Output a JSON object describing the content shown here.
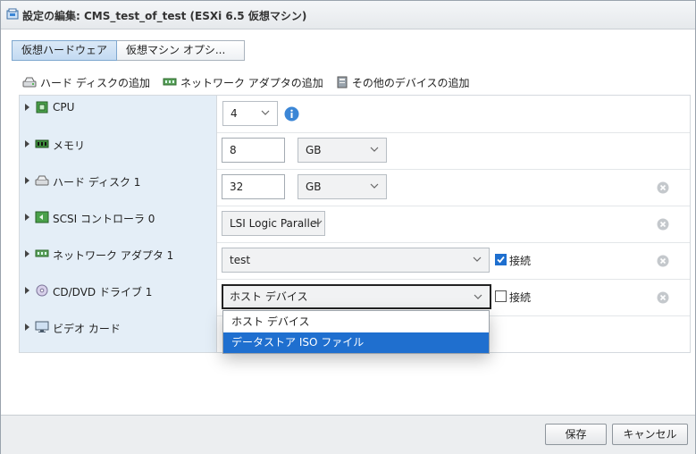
{
  "window": {
    "title": "設定の編集: CMS_test_of_test (ESXi 6.5 仮想マシン)",
    "icon": "vm-settings-icon"
  },
  "tabs": [
    {
      "label": "仮想ハードウェア",
      "active": true
    },
    {
      "label": "仮想マシン オプシ...",
      "active": false
    }
  ],
  "actions": [
    {
      "label": "ハード ディスクの追加",
      "icon": "hard-disk-icon"
    },
    {
      "label": "ネットワーク アダプタの追加",
      "icon": "network-adapter-icon"
    },
    {
      "label": "その他のデバイスの追加",
      "icon": "other-device-icon"
    }
  ],
  "devices": [
    {
      "label": "CPU",
      "icon": "cpu-icon",
      "select_value": "4",
      "info_icon": "info-icon"
    },
    {
      "label": "メモリ",
      "icon": "memory-icon",
      "input_value": "8",
      "unit": "GB"
    },
    {
      "label": "ハード ディスク 1",
      "icon": "hard-disk-icon",
      "input_value": "32",
      "unit": "GB",
      "remove_icon": "remove-icon"
    },
    {
      "label": "SCSI コントローラ 0",
      "icon": "scsi-controller-icon",
      "select_value": "LSI Logic Parallel",
      "remove_icon": "remove-icon"
    },
    {
      "label": "ネットワーク アダプタ 1",
      "icon": "network-adapter-icon",
      "select_value": "test",
      "checkbox_label": "接続",
      "checked": true,
      "remove_icon": "remove-icon"
    },
    {
      "label": "CD/DVD ドライブ 1",
      "icon": "cd-dvd-icon",
      "select_value": "ホスト デバイス",
      "checkbox_label": "接続",
      "checked": false,
      "remove_icon": "remove-icon"
    },
    {
      "label": "ビデオ カード",
      "icon": "video-card-icon"
    }
  ],
  "dropdown": {
    "options": [
      {
        "label": "ホスト デバイス",
        "selected": false
      },
      {
        "label": "データストア ISO ファイル",
        "selected": true
      }
    ]
  },
  "footer": {
    "save_label": "保存",
    "cancel_label": "キャンセル"
  },
  "colors": {
    "accent": "#1f6fcf",
    "label_bg": "#e4eef7",
    "info": "#3b86d6"
  }
}
